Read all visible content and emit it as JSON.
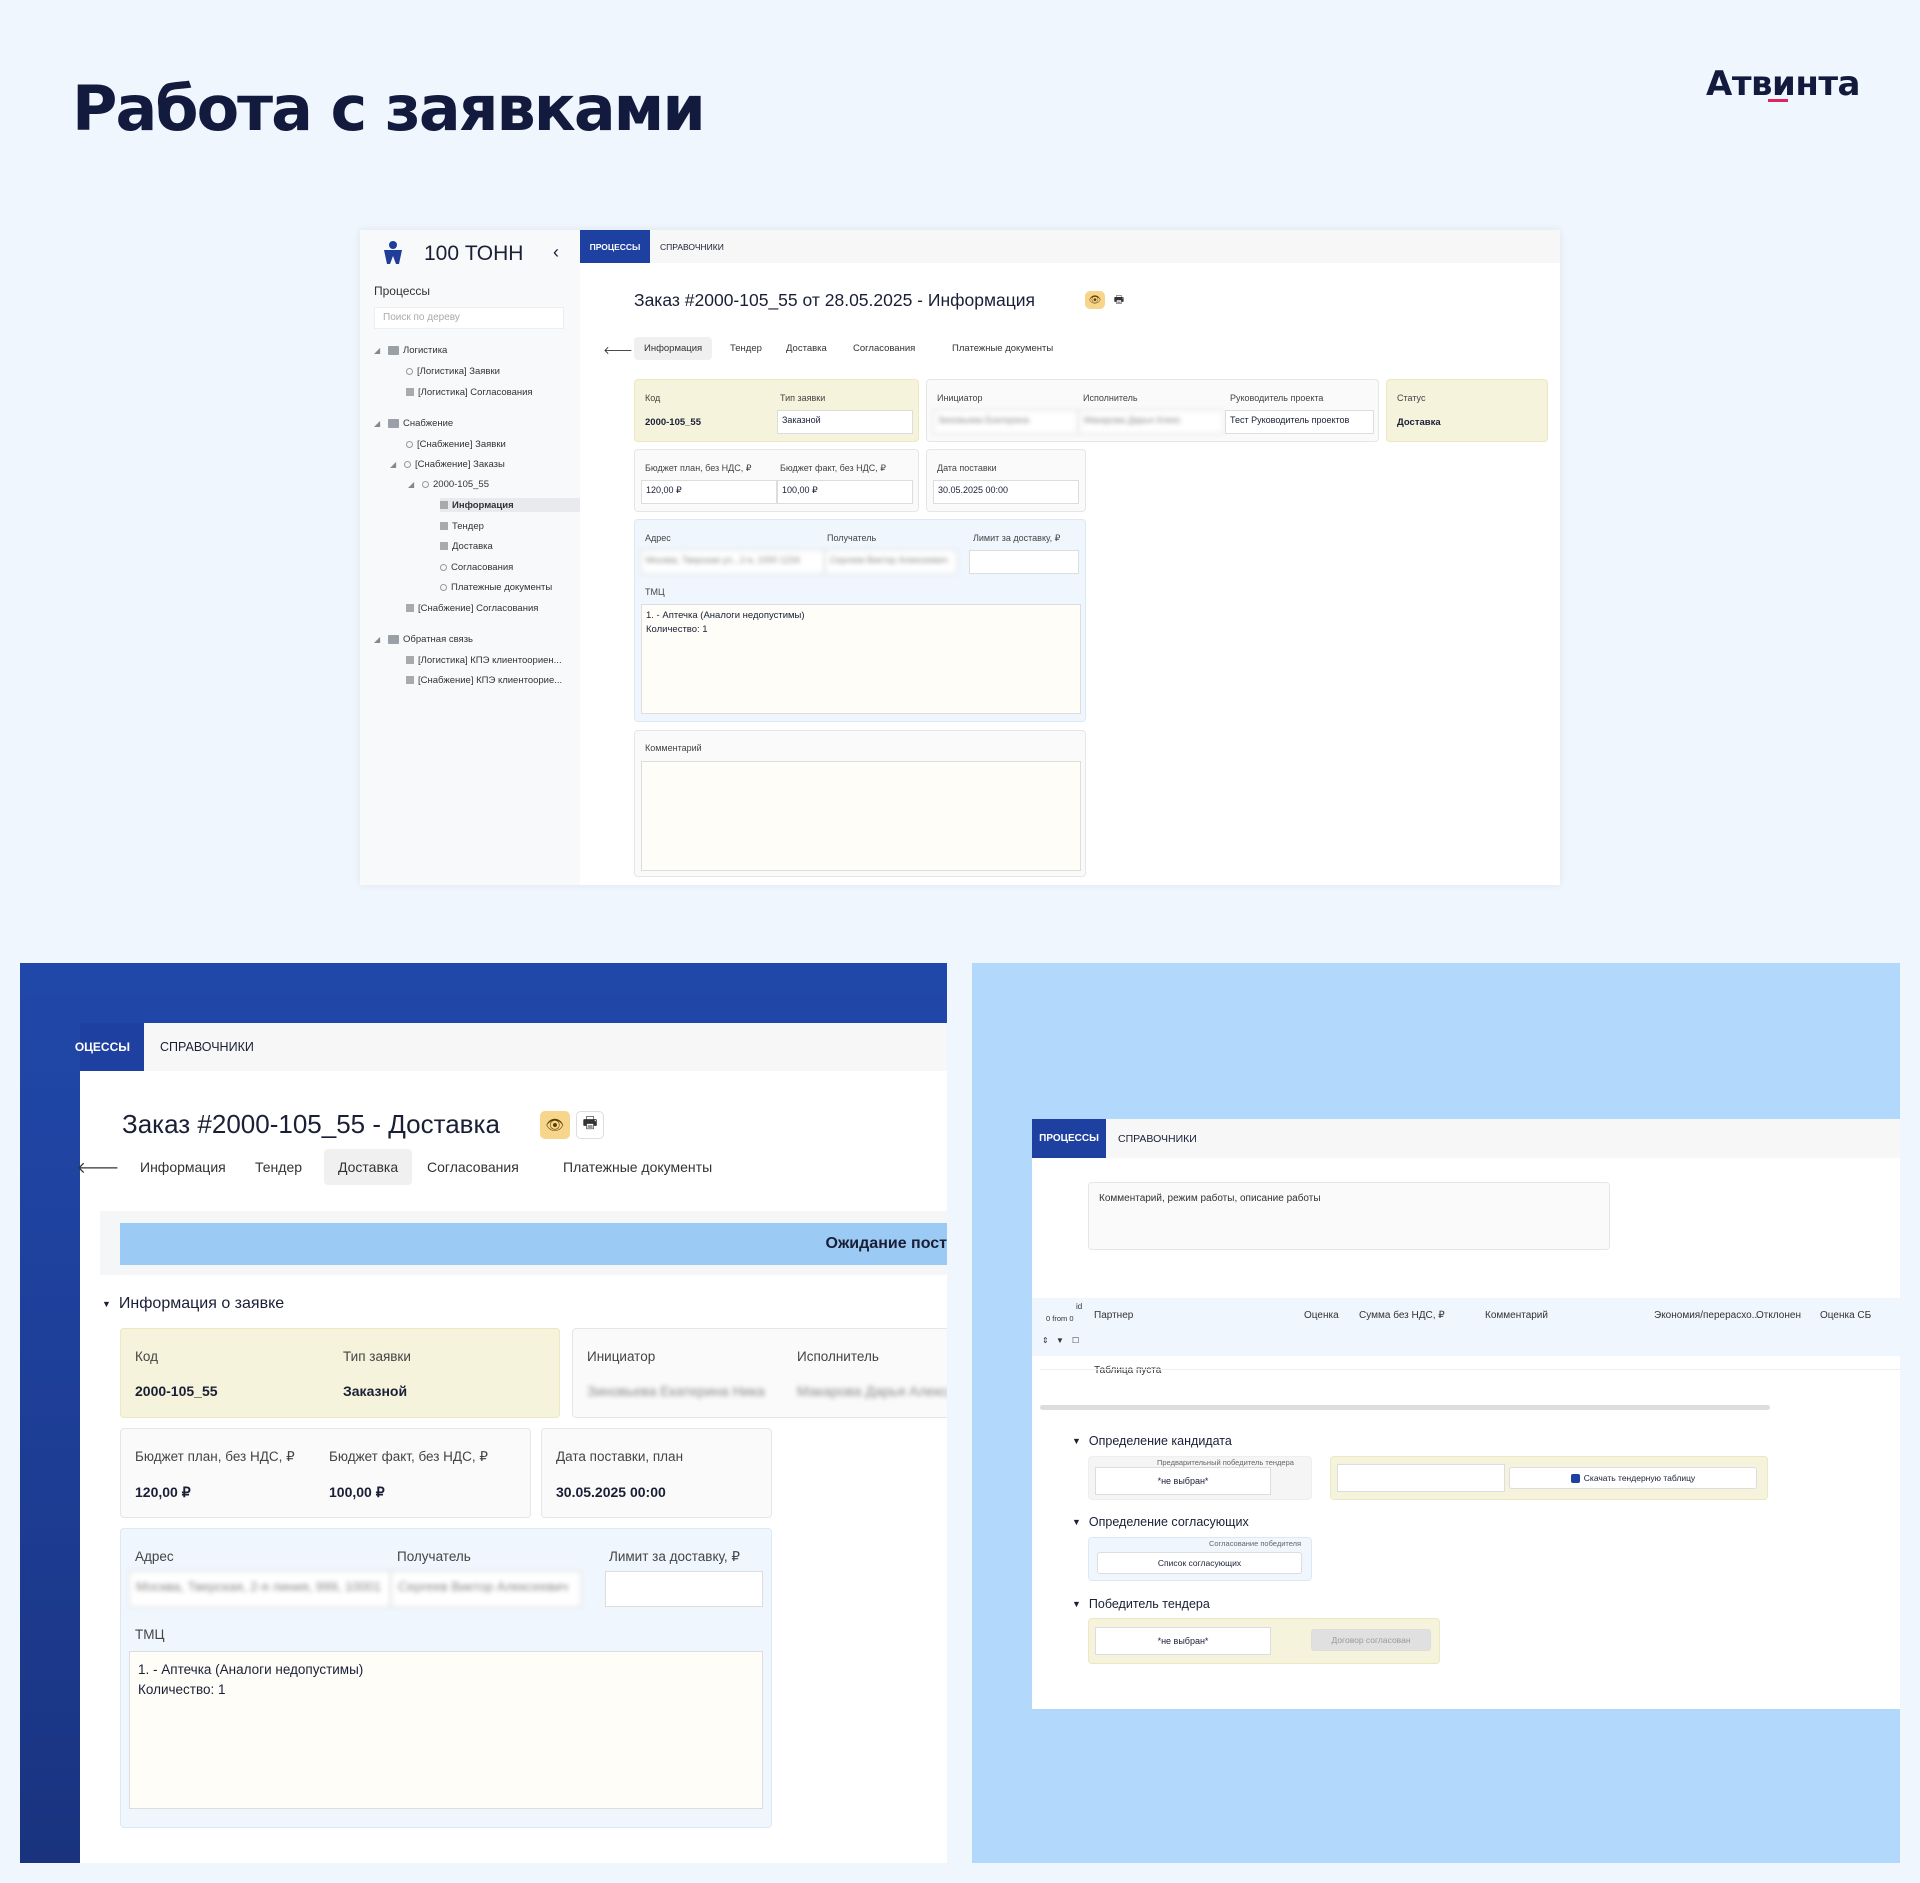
{
  "page": {
    "title": "Работа с заявками",
    "brand": "Атвинта"
  },
  "common": {
    "tab_processes": "ПРОЦЕССЫ",
    "tab_processes_cut": "ОЦЕССЫ",
    "tab_references": "СПРАВОЧНИКИ",
    "subtabs": [
      "Информация",
      "Тендер",
      "Доставка",
      "Согласования",
      "Платежные документы"
    ],
    "back_arrow": "🡐",
    "eye_icon": "👁",
    "print_icon": "🖶",
    "colors": {
      "accent": "#1e40a0",
      "yellow_card": "#f5f3dc",
      "status_banner": "#9bcaf5",
      "bg": "#f0f6fd",
      "blue_panel": "#b2d9fc"
    }
  },
  "screen1": {
    "brand": "100 ТОНН",
    "collapse_icon": "‹",
    "sidebar_section": "Процессы",
    "search_placeholder": "Поиск по дереву",
    "tree": [
      {
        "label": "Логистика"
      },
      {
        "label": "[Логистика] Заявки"
      },
      {
        "label": "[Логистика] Согласования"
      },
      {
        "label": "Снабжение"
      },
      {
        "label": "[Снабжение] Заявки"
      },
      {
        "label": "[Снабжение] Заказы"
      },
      {
        "label": "2000-105_55"
      },
      {
        "label": "Информация"
      },
      {
        "label": "Тендер"
      },
      {
        "label": "Доставка"
      },
      {
        "label": "Согласования"
      },
      {
        "label": "Платежные документы"
      },
      {
        "label": "[Снабжение] Согласования"
      },
      {
        "label": "Обратная связь"
      },
      {
        "label": "[Логистика] КПЭ клиентоориен..."
      },
      {
        "label": "[Снабжение] КПЭ клиентоорие..."
      }
    ],
    "heading": "Заказ #2000-105_55 от 28.05.2025 - Информация",
    "code_label": "Код",
    "code_value": "2000-105_55",
    "type_label": "Тип заявки",
    "type_value": "Заказной",
    "initiator_label": "Инициатор",
    "initiator_value": "Зиновьева Екатерина",
    "executor_label": "Исполнитель",
    "executor_value": "Макарова Дарья Алекс",
    "pm_label": "Руководитель проекта",
    "pm_value": "Тест Руководитель проектов",
    "status_label": "Статус",
    "status_value": "Доставка",
    "budget_plan_label": "Бюджет план, без НДС, ₽",
    "budget_plan_value": "120,00 ₽",
    "budget_fact_label": "Бюджет факт, без НДС, ₽",
    "budget_fact_value": "100,00 ₽",
    "delivery_date_label": "Дата поставки",
    "delivery_date_value": "30.05.2025 00:00",
    "address_label": "Адрес",
    "address_value": "Москва, Тверская ул., 2-я, 1000 1234",
    "receiver_label": "Получатель",
    "receiver_value": "Сергеев Виктор Алексеевич",
    "limit_label": "Лимит за доставку, ₽",
    "tmc_label": "ТМЦ",
    "tmc_value": "1. - Аптечка (Аналоги недопустимы)\nКоличество: 1",
    "comment_label": "Комментарий"
  },
  "screen2": {
    "heading": "Заказ #2000-105_55 - Доставка",
    "status_banner": "Ожидание пост",
    "section_title": "Информация о заявке",
    "code_label": "Код",
    "code_value": "2000-105_55",
    "type_label": "Тип заявки",
    "type_value": "Заказной",
    "initiator_label": "Инициатор",
    "initiator_value": "Зиновьева Екатерина Ника",
    "executor_label": "Исполнитель",
    "executor_value": "Макарова Дарья Алексан",
    "budget_plan_label": "Бюджет план, без НДС, ₽",
    "budget_plan_value": "120,00 ₽",
    "budget_fact_label": "Бюджет факт, без НДС, ₽",
    "budget_fact_value": "100,00 ₽",
    "delivery_date_label": "Дата поставки, план",
    "delivery_date_value": "30.05.2025 00:00",
    "address_label": "Адрес",
    "address_value": "Москва, Тверская, 2-я линия, 999, 10001",
    "receiver_label": "Получатель",
    "receiver_value": "Сергеев Виктор Алексеевич",
    "limit_label": "Лимит за доставку, ₽",
    "tmc_label": "ТМЦ",
    "tmc_value": "1. - Аптечка (Аналоги недопустимы)\nКоличество: 1"
  },
  "screen3": {
    "comment_placeholder": "Комментарий, режим работы, описание работы",
    "table": {
      "id_label": "id",
      "counter": "0 from 0",
      "columns": [
        "Партнер",
        "Оценка",
        "Сумма без НДС, ₽",
        "Комментарий",
        "Экономия/перерасхо...",
        "Отклонен",
        "Оценка СБ"
      ],
      "empty": "Таблица пуста"
    },
    "candidate_section": "Определение кандидата",
    "preliminary_winner_label": "Предварительный победитель тендера",
    "not_selected": "*не выбран*",
    "download_button": "Скачать тендерную таблицу",
    "approvers_section": "Определение согласующих",
    "winner_approval_label": "Согласование победителя",
    "approvers_button": "Список согласующих",
    "winner_section": "Победитель тендера",
    "contract_button": "Договор согласован"
  }
}
